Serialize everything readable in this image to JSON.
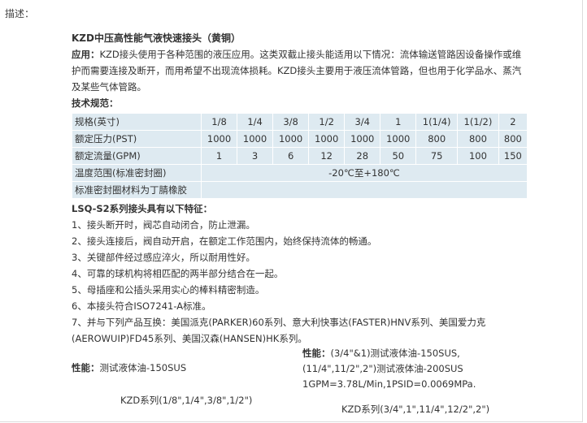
{
  "description_label": "描述：",
  "title": "KZD中压高性能气液快速接头（黄铜）",
  "application": {
    "label": "应用：",
    "text": "KZD接头使用于各种范围的液压应用。这类双截止接头能适用以下情况：流体输送管路因设备操作或维护而需要连接及断开，而用希望不出现流体损耗。KZD接头主要用于液压流体管路，但也用于化学品水、蒸汽及某些气体管路。"
  },
  "spec_title": "技术规范：",
  "spec_table": {
    "rows": [
      {
        "label": "规格(英寸)",
        "values": [
          "1/8",
          "1/4",
          "3/8",
          "1/2",
          "3/4",
          "1",
          "1(1/4)",
          "1(1/2)",
          "2"
        ]
      },
      {
        "label": "额定压力(PST)",
        "values": [
          "1000",
          "1000",
          "1000",
          "1000",
          "1000",
          "1000",
          "800",
          "800",
          "800"
        ]
      },
      {
        "label": "额定流量(GPM)",
        "values": [
          "1",
          "3",
          "6",
          "12",
          "28",
          "50",
          "75",
          "100",
          "150"
        ]
      }
    ],
    "temperature": {
      "label": "温度范围(标准密封圈)",
      "value": "-20℃至+180℃"
    },
    "seal_note": "标准密封圈材料为丁腈橡胶"
  },
  "lsq_title": "LSQ-S2系列接头具有以下特征：",
  "features": [
    "1、接头断开时，阀芯自动闭合，防止泄漏。",
    "2、接头连接后，阀自动开启，在额定工作范围内，始终保持流体的畅通。",
    "3、关键部件经过感应淬火，所以耐用性好。",
    "4、可靠的球机构将相匹配的两半部分结合在一起。",
    "5、母插座和公插头采用实心的棒料精密制造。",
    "6、本接头符合ISO7241-A标准。",
    "7、并与下列产品互换：美国派克(PARKER)60系列、意大利快事达(FASTER)HNV系列、美国爱力克(AEROWUIP)FD45系列、美国汉森(HANSEN)HK系列。"
  ],
  "performance_left": {
    "label": "性能：",
    "text": "测试液体油-150SUS",
    "caption": "KZD系列(1/8\",1/4\",3/8\",1/2\")"
  },
  "performance_right": {
    "label": "性能：",
    "line1": "(3/4\"&1)测试液体油-150SUS,",
    "line2": "(11/4\",11/2\",2\")测试液体油-200SUS",
    "line3": "1GPM=3.78L/Min,1PSID=0.0069MPa.",
    "caption": "KZD系列(3/4\",1\",11/4\",12/2\",2\")"
  }
}
